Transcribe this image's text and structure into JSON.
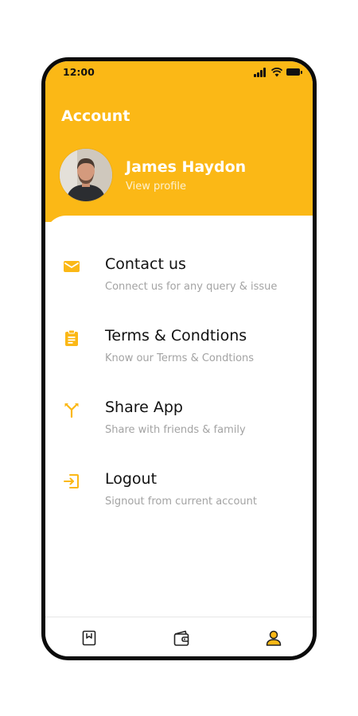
{
  "status_bar": {
    "time": "12:00"
  },
  "header": {
    "title": "Account"
  },
  "profile": {
    "name": "James Haydon",
    "link_label": "View profile"
  },
  "menu": [
    {
      "id": "contact",
      "title": "Contact us",
      "subtitle": "Connect us for any query & issue",
      "icon": "mail-icon"
    },
    {
      "id": "terms",
      "title": "Terms & Condtions",
      "subtitle": "Know our Terms & Condtions",
      "icon": "clipboard-icon"
    },
    {
      "id": "share",
      "title": "Share App",
      "subtitle": "Share with friends & family",
      "icon": "share-fork-icon"
    },
    {
      "id": "logout",
      "title": "Logout",
      "subtitle": "Signout from current account",
      "icon": "logout-icon"
    }
  ],
  "bottom_nav": [
    {
      "id": "bookmarks",
      "icon": "bookmark-icon",
      "active": false
    },
    {
      "id": "wallet",
      "icon": "wallet-icon",
      "active": false
    },
    {
      "id": "account",
      "icon": "user-icon",
      "active": true
    }
  ],
  "colors": {
    "accent": "#fbb816",
    "text": "#111111",
    "muted": "#a3a3a3"
  }
}
